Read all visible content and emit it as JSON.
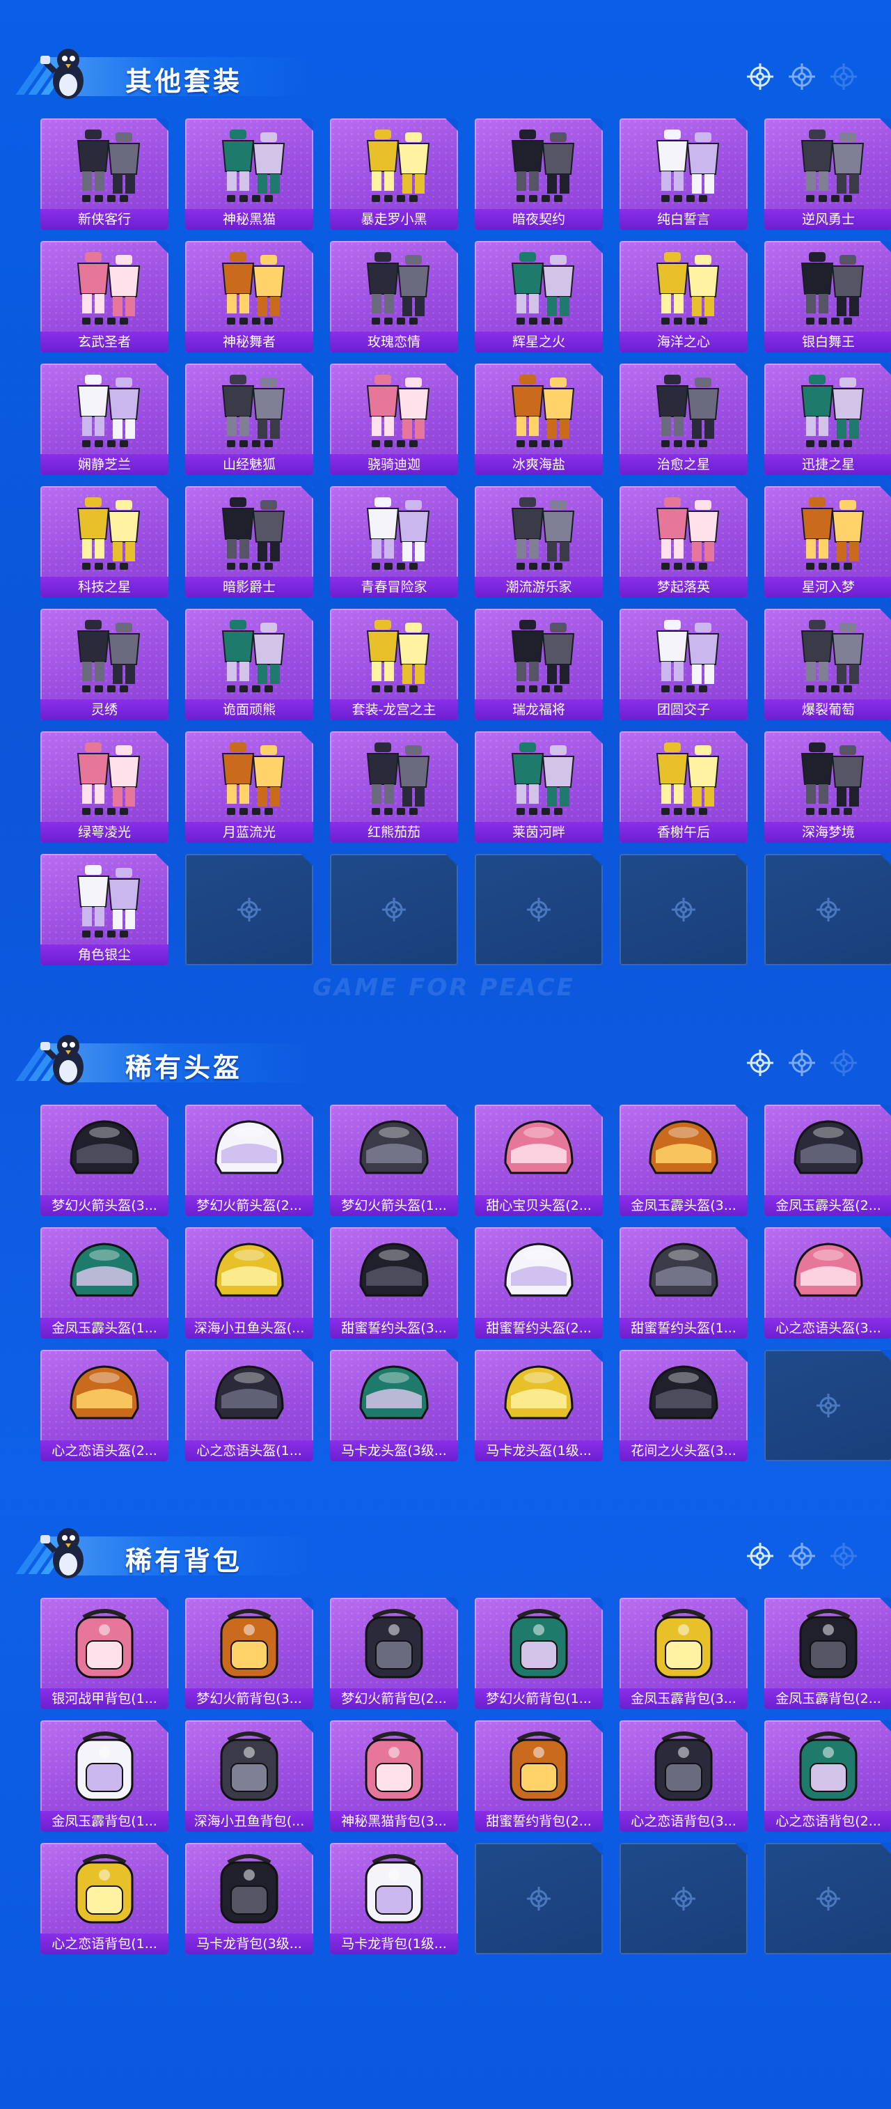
{
  "watermark": "GAME FOR PEACE",
  "colors": {
    "background": "#0b58df",
    "card": "#a55ae8",
    "label_bar": "#7a26dc",
    "empty_tile": "#1d4582"
  },
  "icons": {
    "mascot": "penguin-mascot-icon",
    "target": "crosshair-target-icon"
  },
  "sections": [
    {
      "key": "suits",
      "title": "其他套装",
      "columns": 6,
      "items": [
        "新侠客行",
        "神秘黑猫",
        "暴走罗小黑",
        "暗夜契约",
        "纯白誓言",
        "逆风勇士",
        "玄武圣者",
        "神秘舞者",
        "玫瑰恋情",
        "辉星之火",
        "海洋之心",
        "银白舞王",
        "娴静芝兰",
        "山经魅狐",
        "骁骑迪迦",
        "冰爽海盐",
        "治愈之星",
        "迅捷之星",
        "科技之星",
        "暗影爵士",
        "青春冒险家",
        "潮流游乐家",
        "梦起落英",
        "星河入梦",
        "灵绣",
        "诡面顽熊",
        "套装-龙宫之主",
        "瑞龙福将",
        "团圆交子",
        "爆裂葡萄",
        "绿萼凌光",
        "月蓝流光",
        "红熊茄茄",
        "莱茵河畔",
        "香榭午后",
        "深海梦境",
        "角色银尘"
      ],
      "empty_slots": 5
    },
    {
      "key": "helmets",
      "title": "稀有头盔",
      "columns": 6,
      "items": [
        "梦幻火箭头盔(3...",
        "梦幻火箭头盔(2...",
        "梦幻火箭头盔(1...",
        "甜心宝贝头盔(2...",
        "金凤玉霹头盔(3...",
        "金凤玉霹头盔(2...",
        "金凤玉霹头盔(1...",
        "深海小丑鱼头盔(...",
        "甜蜜誓约头盔(3...",
        "甜蜜誓约头盔(2...",
        "甜蜜誓约头盔(1...",
        "心之恋语头盔(3...",
        "心之恋语头盔(2...",
        "心之恋语头盔(1...",
        "马卡龙头盔(3级...",
        "马卡龙头盔(1级...",
        "花间之火头盔(3..."
      ],
      "empty_slots": 1
    },
    {
      "key": "backpacks",
      "title": "稀有背包",
      "columns": 6,
      "items": [
        "银河战甲背包(1...",
        "梦幻火箭背包(3...",
        "梦幻火箭背包(2...",
        "梦幻火箭背包(1...",
        "金凤玉霹背包(3...",
        "金凤玉霹背包(2...",
        "金凤玉霹背包(1...",
        "深海小丑鱼背包(...",
        "神秘黑猫背包(3...",
        "甜蜜誓约背包(2...",
        "心之恋语背包(3...",
        "心之恋语背包(2...",
        "心之恋语背包(1...",
        "马卡龙背包(3级...",
        "马卡龙背包(1级..."
      ],
      "empty_slots": 3
    }
  ]
}
